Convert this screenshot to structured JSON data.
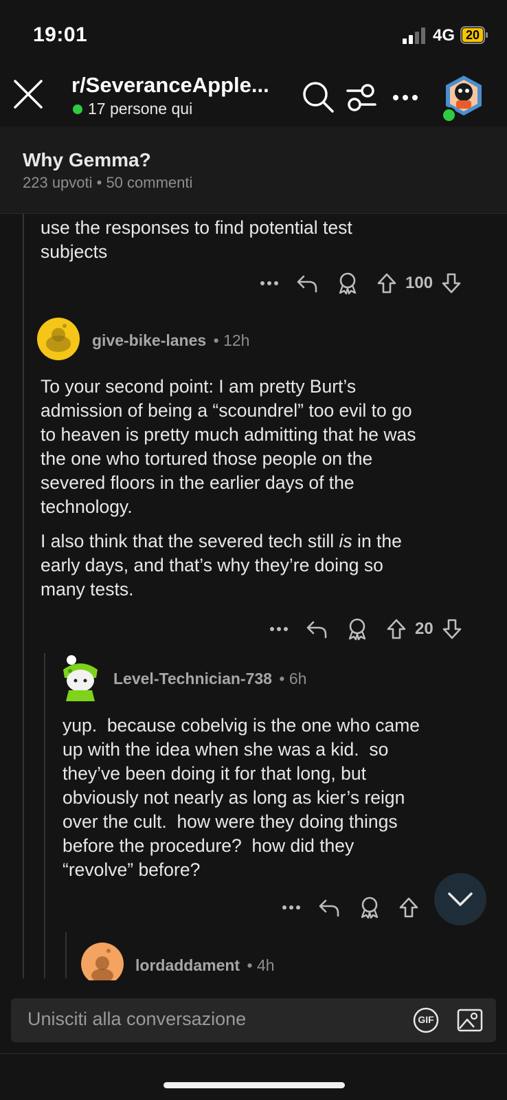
{
  "status": {
    "time": "19:01",
    "network": "4G",
    "battery": "20"
  },
  "header": {
    "subreddit": "r/SeveranceApple...",
    "online": "17 persone qui"
  },
  "post": {
    "title": "Why Gemma?",
    "meta": "223 upvoti • 50 commenti"
  },
  "comments": [
    {
      "lines": [
        "use the responses to find potential test",
        "subjects"
      ],
      "votes": "100"
    },
    {
      "author": "give-bike-lanes",
      "age": "• 12h",
      "para1": [
        "To your second point: I am pretty Burt’s",
        "admission of being a “scoundrel” too evil to go",
        "to heaven is pretty much admitting that he was",
        "the one who tortured those people on the",
        "severed floors in the earlier days of the",
        "technology."
      ],
      "para2_a": "I also think that the severed tech still ",
      "para2_em": "is",
      "para2_b": " in the",
      "para2_rest": [
        "early days, and that’s why they’re doing so",
        "many tests."
      ],
      "votes": "20",
      "avatar_color": "#f5c518"
    },
    {
      "author": "Level-Technician-738",
      "age": "• 6h",
      "lines": [
        "yup.  because cobelvig is the one who came",
        "up with the idea when she was a kid.  so",
        "they’ve been doing it for that long, but",
        "obviously not nearly as long as kier’s reign",
        "over the cult.  how were they doing things",
        "before the procedure?  how did they",
        "“revolve” before?"
      ]
    },
    {
      "author": "lordaddament",
      "age": "• 4h",
      "avatar_color": "#f4a460"
    }
  ],
  "composer": {
    "placeholder": "Unisciti alla conversazione",
    "gif_label": "GIF"
  },
  "icons": [
    "close-icon",
    "search-icon",
    "filter-icon",
    "more-icon",
    "reply-icon",
    "award-icon",
    "upvote-icon",
    "downvote-icon",
    "chevron-down-icon",
    "gif-icon",
    "image-icon"
  ]
}
